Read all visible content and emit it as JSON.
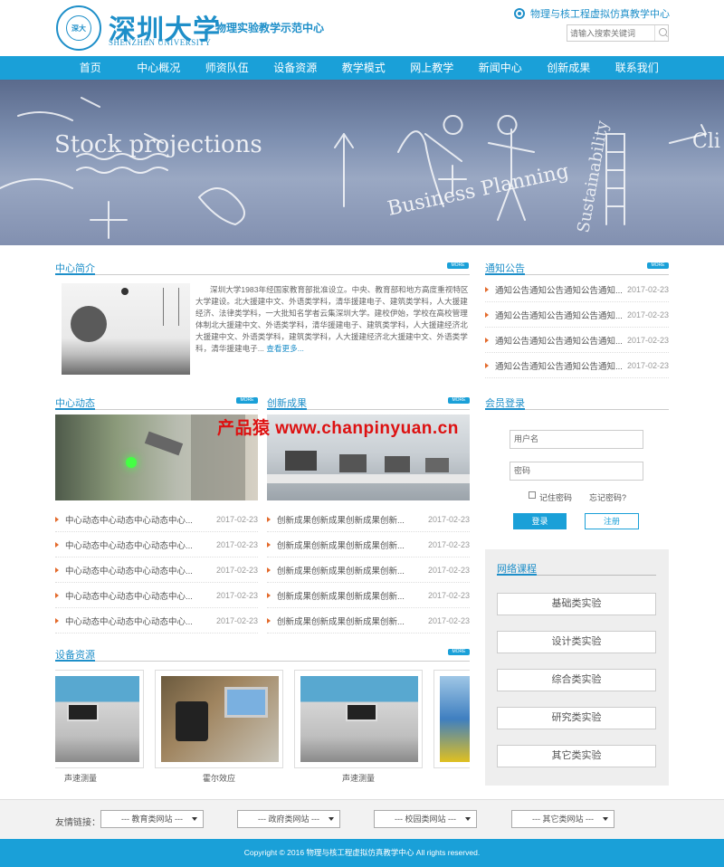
{
  "header": {
    "logo_text": "深圳大学",
    "logo_en": "SHENZHEN UNIVERSITY",
    "logo_seal": "深大",
    "logo_sub": "物理实验教学示范中心",
    "site_link": "物理与核工程虚拟仿真教学中心",
    "search_placeholder": "请输入搜索关键词"
  },
  "nav": [
    "首页",
    "中心概况",
    "师资队伍",
    "设备资源",
    "教学模式",
    "网上教学",
    "新闻中心",
    "创新成果",
    "联系我们"
  ],
  "banner": {
    "texts": [
      "Stock projections",
      "Business Planning",
      "Sustainability",
      "Cli"
    ]
  },
  "more_label": "MORE",
  "intro": {
    "title": "中心简介",
    "text": "深圳大学1983年经国家教育部批准设立。中央、教育部和地方高度重视特区大学建设。北大援建中文、外语类学科，清华援建电子、建筑类学科，人大援建经济、法律类学科，一大批知名学者云集深圳大学。建校伊始，学校在高校管理体制北大援建中文、外语类学科，清华援建电子、建筑类学科，人大援建经济北大援建中文、外语类学科，建筑类学科，人大援建经济北大援建中文、外语类学科，清华援建电子...",
    "more": "查看更多..."
  },
  "notice": {
    "title": "通知公告",
    "items": [
      {
        "t": "通知公告通知公告通知公告通知...",
        "d": "2017-02-23"
      },
      {
        "t": "通知公告通知公告通知公告通知...",
        "d": "2017-02-23"
      },
      {
        "t": "通知公告通知公告通知公告通知...",
        "d": "2017-02-23"
      },
      {
        "t": "通知公告通知公告通知公告通知...",
        "d": "2017-02-23"
      }
    ]
  },
  "dynamics": {
    "title": "中心动态",
    "items": [
      {
        "t": "中心动态中心动态中心动态中心...",
        "d": "2017-02-23"
      },
      {
        "t": "中心动态中心动态中心动态中心...",
        "d": "2017-02-23"
      },
      {
        "t": "中心动态中心动态中心动态中心...",
        "d": "2017-02-23"
      },
      {
        "t": "中心动态中心动态中心动态中心...",
        "d": "2017-02-23"
      },
      {
        "t": "中心动态中心动态中心动态中心...",
        "d": "2017-02-23"
      }
    ]
  },
  "achieve": {
    "title": "创新成果",
    "items": [
      {
        "t": "创新成果创新成果创新成果创新...",
        "d": "2017-02-23"
      },
      {
        "t": "创新成果创新成果创新成果创新...",
        "d": "2017-02-23"
      },
      {
        "t": "创新成果创新成果创新成果创新...",
        "d": "2017-02-23"
      },
      {
        "t": "创新成果创新成果创新成果创新...",
        "d": "2017-02-23"
      },
      {
        "t": "创新成果创新成果创新成果创新...",
        "d": "2017-02-23"
      }
    ]
  },
  "watermark": "产品猿 www.chanpinyuan.cn",
  "login": {
    "title": "会员登录",
    "user_placeholder": "用户名",
    "pass_placeholder": "密码",
    "remember": "记住密码",
    "forgot": "忘记密码?",
    "login_btn": "登录",
    "register_btn": "注册"
  },
  "courses": {
    "title": "网络课程",
    "items": [
      "基础类实验",
      "设计类实验",
      "综合类实验",
      "研究类实验",
      "其它类实验"
    ]
  },
  "equipment": {
    "title": "设备资源",
    "items": [
      "声速测量",
      "霍尔效应",
      "声速测量",
      ""
    ]
  },
  "friends": {
    "label": "友情链接：",
    "selects": [
      "--- 教育类网站 ---",
      "--- 政府类网站 ---",
      "--- 校园类网站 ---",
      "--- 其它类网站 ---"
    ]
  },
  "copyright": "Copyright © 2016 物理与核工程虚拟仿真教学中心 All rights reserved."
}
